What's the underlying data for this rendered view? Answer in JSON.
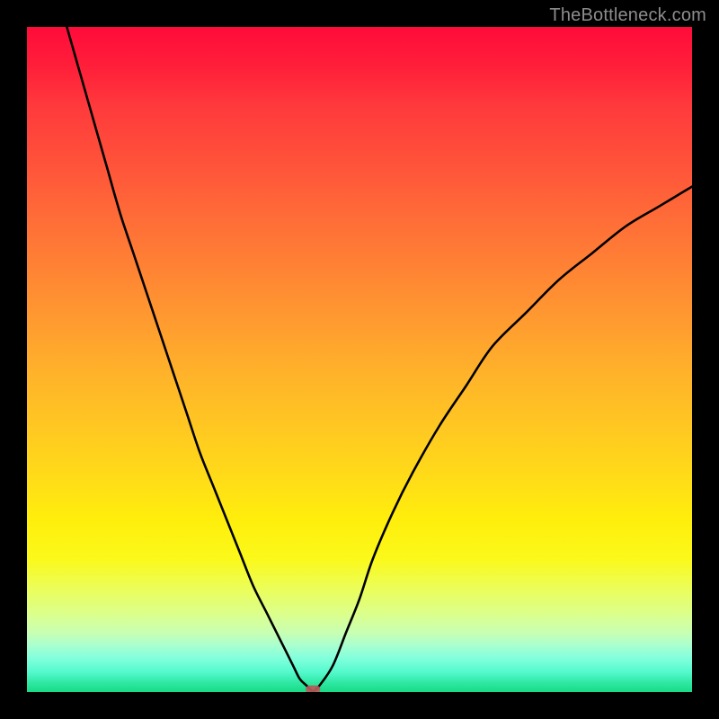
{
  "watermark": "TheBottleneck.com",
  "chart_data": {
    "type": "line",
    "title": "",
    "xlabel": "",
    "ylabel": "",
    "xlim": [
      0,
      100
    ],
    "ylim": [
      0,
      100
    ],
    "grid": false,
    "legend": null,
    "background_gradient": {
      "top": "#ff0b3a",
      "bottom": "#17db85",
      "note": "red→orange→yellow→green vertical gradient"
    },
    "series": [
      {
        "name": "left-branch",
        "x": [
          6,
          8,
          10,
          12,
          14,
          16,
          18,
          20,
          22,
          24,
          26,
          28,
          30,
          32,
          34,
          36,
          38,
          40,
          41,
          42,
          43
        ],
        "y": [
          100,
          93,
          86,
          79,
          72,
          66,
          60,
          54,
          48,
          42,
          36,
          31,
          26,
          21,
          16,
          12,
          8,
          4,
          2,
          1,
          0
        ]
      },
      {
        "name": "right-branch",
        "x": [
          43,
          44,
          46,
          48,
          50,
          52,
          55,
          58,
          62,
          66,
          70,
          75,
          80,
          85,
          90,
          95,
          100
        ],
        "y": [
          0,
          1,
          4,
          9,
          14,
          20,
          27,
          33,
          40,
          46,
          52,
          57,
          62,
          66,
          70,
          73,
          76
        ]
      }
    ],
    "marker": {
      "x": 43,
      "y": 0,
      "color": "#b55a5a",
      "shape": "rounded-rect"
    }
  }
}
